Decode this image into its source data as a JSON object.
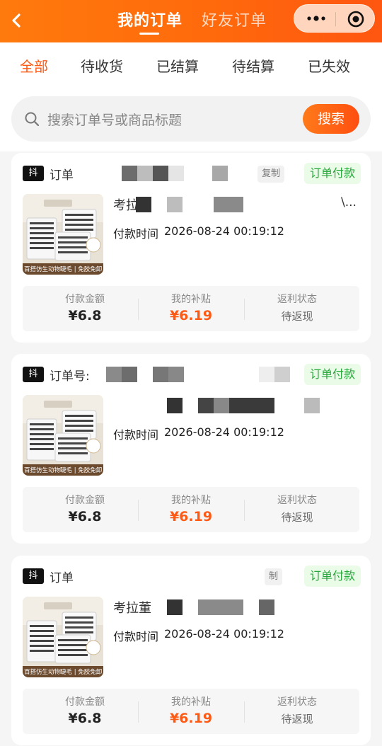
{
  "header": {
    "tabs": [
      {
        "label": "我的订单",
        "active": true
      },
      {
        "label": "好友订单",
        "active": false
      }
    ],
    "accent_color": "#ff6a0c"
  },
  "filters": {
    "tabs": [
      "全部",
      "待收货",
      "已结算",
      "待结算",
      "已失效"
    ],
    "active_index": 0
  },
  "search": {
    "placeholder": "搜索订单号或商品标题",
    "button_label": "搜索"
  },
  "orders": [
    {
      "platform_badge": "抖",
      "order_label": "订单",
      "tag": "复制",
      "status": "订单付款",
      "title": "考拉",
      "title_suffix": "\\...",
      "thumb_caption": "百搭仿生动物睫毛 | 免胶免卸",
      "paytime_label": "付款时间",
      "paytime": "2026-08-24 00:19:12",
      "pay_amount_label": "付款金额",
      "pay_amount": "¥6.8",
      "subsidy_label": "我的补贴",
      "subsidy": "¥6.19",
      "rebate_label": "返利状态",
      "rebate_status": "待返现"
    },
    {
      "platform_badge": "抖",
      "order_label": "订单号:",
      "tag": "",
      "status": "订单付款",
      "title": "",
      "title_suffix": "",
      "thumb_caption": "百搭仿生动物睫毛 | 免胶免卸",
      "paytime_label": "付款时间",
      "paytime": "2026-08-24 00:19:12",
      "pay_amount_label": "付款金额",
      "pay_amount": "¥6.8",
      "subsidy_label": "我的补贴",
      "subsidy": "¥6.19",
      "rebate_label": "返利状态",
      "rebate_status": "待返现"
    },
    {
      "platform_badge": "抖",
      "order_label": "订单",
      "tag": "制",
      "status": "订单付款",
      "title": "考拉董",
      "title_suffix": "",
      "thumb_caption": "百搭仿生动物睫毛 | 免胶免卸",
      "paytime_label": "付款时间",
      "paytime": "2026-08-24 00:19:12",
      "pay_amount_label": "付款金额",
      "pay_amount": "¥6.8",
      "subsidy_label": "我的补贴",
      "subsidy": "¥6.19",
      "rebate_label": "返利状态",
      "rebate_status": "待返现"
    }
  ]
}
